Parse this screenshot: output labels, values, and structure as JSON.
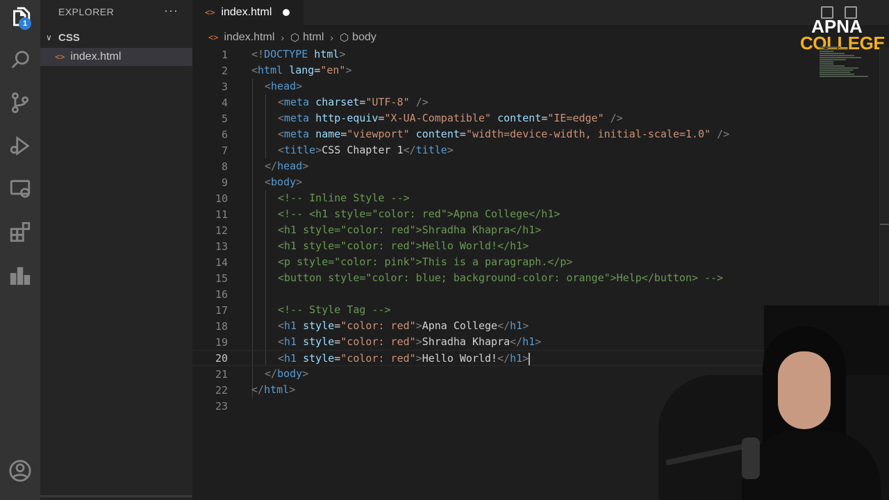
{
  "activity_bar": {
    "items": [
      {
        "name": "explorer-icon",
        "active": true,
        "badge": "1"
      },
      {
        "name": "search-icon"
      },
      {
        "name": "source-control-icon"
      },
      {
        "name": "run-debug-icon"
      },
      {
        "name": "remote-explorer-icon"
      },
      {
        "name": "extensions-icon"
      },
      {
        "name": "stats-icon"
      },
      {
        "name": "account-icon"
      }
    ]
  },
  "sidebar": {
    "title": "EXPLORER",
    "more": "···",
    "folder": {
      "chevron": "∨",
      "name": "CSS"
    },
    "files": [
      {
        "icon": "<>",
        "name": "index.html"
      }
    ]
  },
  "tab": {
    "icon": "<>",
    "name": "index.html",
    "modified": true
  },
  "breadcrumb": [
    "index.html",
    "html",
    "body"
  ],
  "logo": {
    "line1": "APNA",
    "line2": "COLLEGE"
  },
  "colors": {
    "accent": "#2f7fd4",
    "html_icon": "#e37933",
    "logo_gold": "#f5b122"
  },
  "editor": {
    "current_line": 20,
    "lines": [
      {
        "n": "1"
      },
      {
        "n": "2"
      },
      {
        "n": "3"
      },
      {
        "n": "4"
      },
      {
        "n": "5"
      },
      {
        "n": "6"
      },
      {
        "n": "7"
      },
      {
        "n": "8"
      },
      {
        "n": "9"
      },
      {
        "n": "10"
      },
      {
        "n": "11"
      },
      {
        "n": "12"
      },
      {
        "n": "13"
      },
      {
        "n": "14"
      },
      {
        "n": "15"
      },
      {
        "n": "16"
      },
      {
        "n": "17"
      },
      {
        "n": "18"
      },
      {
        "n": "19"
      },
      {
        "n": "20"
      },
      {
        "n": "21"
      },
      {
        "n": "22"
      },
      {
        "n": "23"
      }
    ],
    "code": {
      "l1": {
        "open": "<!",
        "tag": "DOCTYPE",
        "attr": " html",
        "close": ">"
      },
      "l2": {
        "tag": "html",
        "attr": "lang",
        "val": "\"en\""
      },
      "l3": {
        "tag": "head"
      },
      "l4": {
        "tag": "meta",
        "attr": "charset",
        "val": "\"UTF-8\""
      },
      "l5": {
        "tag": "meta",
        "attr1": "http-equiv",
        "val1": "\"X-UA-Compatible\"",
        "attr2": "content",
        "val2": "\"IE=edge\""
      },
      "l6": {
        "tag": "meta",
        "attr1": "name",
        "val1": "\"viewport\"",
        "attr2": "content",
        "val2": "\"width=device-width, initial-scale=1.0\""
      },
      "l7": {
        "tag": "title",
        "text": "CSS Chapter 1",
        "ctag": "title"
      },
      "l8": {
        "tag": "head"
      },
      "l9": {
        "tag": "body"
      },
      "l10": "<!-- Inline Style -->",
      "l11": "<!-- <h1 style=\"color: red\">Apna College</h1>",
      "l12": "<h1 style=\"color: red\">Shradha Khapra</h1>",
      "l13": "<h1 style=\"color: red\">Hello World!</h1>",
      "l14": "<p style=\"color: pink\">This is a paragraph.</p>",
      "l15": "<button style=\"color: blue; background-color: orange\">Help</button> -->",
      "l17": "<!-- Style Tag -->",
      "l18": {
        "tag": "h1",
        "attr": "style",
        "val": "\"color: red\"",
        "text": "Apna College",
        "ctag": "h1"
      },
      "l19": {
        "tag": "h1",
        "attr": "style",
        "val": "\"color: red\"",
        "text": "Shradha Khapra",
        "ctag": "h1"
      },
      "l20": {
        "tag": "h1",
        "attr": "style",
        "val": "\"color: red\"",
        "text": "Hello World!",
        "ctag": "h1"
      },
      "l21": {
        "tag": "body"
      },
      "l22": {
        "tag": "html"
      }
    }
  }
}
